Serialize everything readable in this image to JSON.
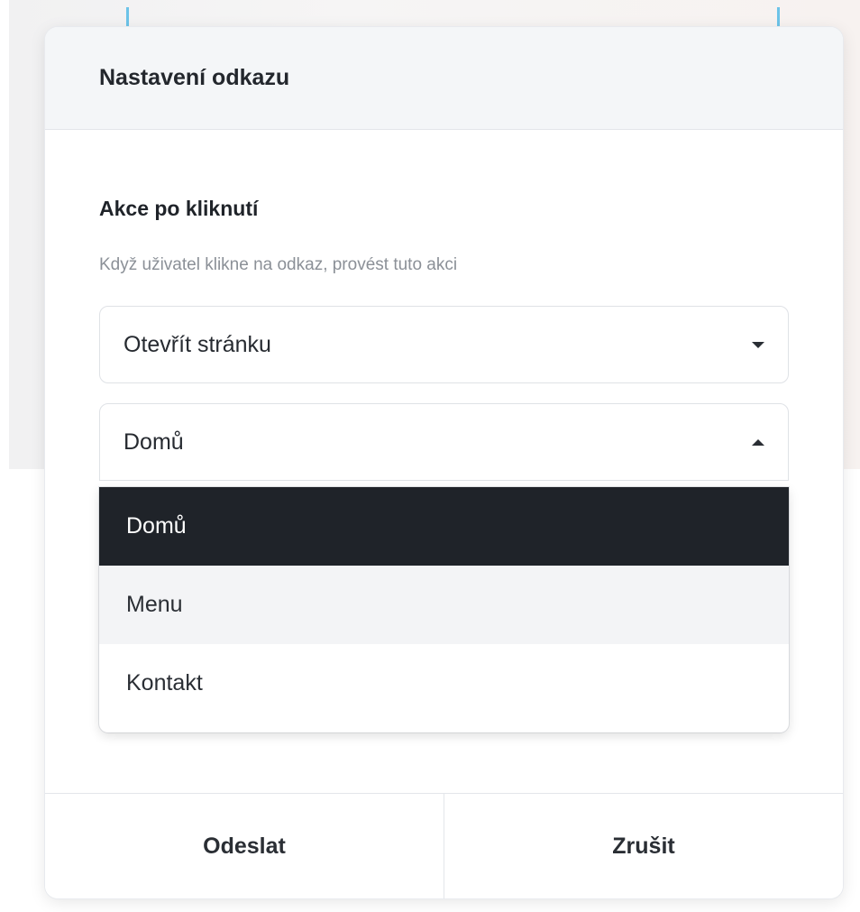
{
  "dialog": {
    "title": "Nastavení odkazu",
    "section_label": "Akce po kliknutí",
    "section_help": "Když uživatel klikne na odkaz, provést tuto akci"
  },
  "action_select": {
    "value": "Otevřít stránku",
    "icon": "chevron-down-icon"
  },
  "page_select": {
    "value": "Domů",
    "icon": "chevron-up-icon",
    "open": true,
    "options": [
      {
        "label": "Domů",
        "state": "selected"
      },
      {
        "label": "Menu",
        "state": "hover"
      },
      {
        "label": "Kontakt",
        "state": "normal"
      }
    ]
  },
  "footer": {
    "submit_label": "Odeslat",
    "cancel_label": "Zrušit"
  },
  "colors": {
    "selected_bg": "#1f2329",
    "hover_bg": "#f3f4f6",
    "header_bg": "#f4f6f8"
  }
}
